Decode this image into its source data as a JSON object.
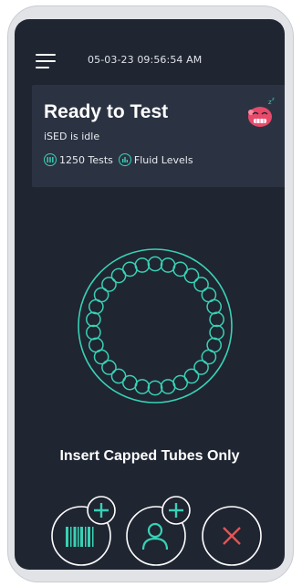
{
  "header": {
    "datetime": "05-03-23 09:56:54 AM",
    "menu_icon": "hamburger-menu-icon"
  },
  "status": {
    "title": "Ready to Test",
    "subtitle": "iSED is idle",
    "tests_label": "1250 Tests",
    "fluid_label": "Fluid Levels",
    "mascot_icon": "sleeping-mascot-icon"
  },
  "tube_holder": {
    "slot_count": 30
  },
  "instruction": "Insert Capped Tubes Only",
  "actions": {
    "scan_icon": "barcode-add-icon",
    "patient_icon": "add-person-icon",
    "cancel_icon": "close-icon"
  },
  "colors": {
    "accent": "#38d1b5",
    "background": "#1f2531",
    "card": "#2b3342",
    "cancel": "#e35454"
  }
}
